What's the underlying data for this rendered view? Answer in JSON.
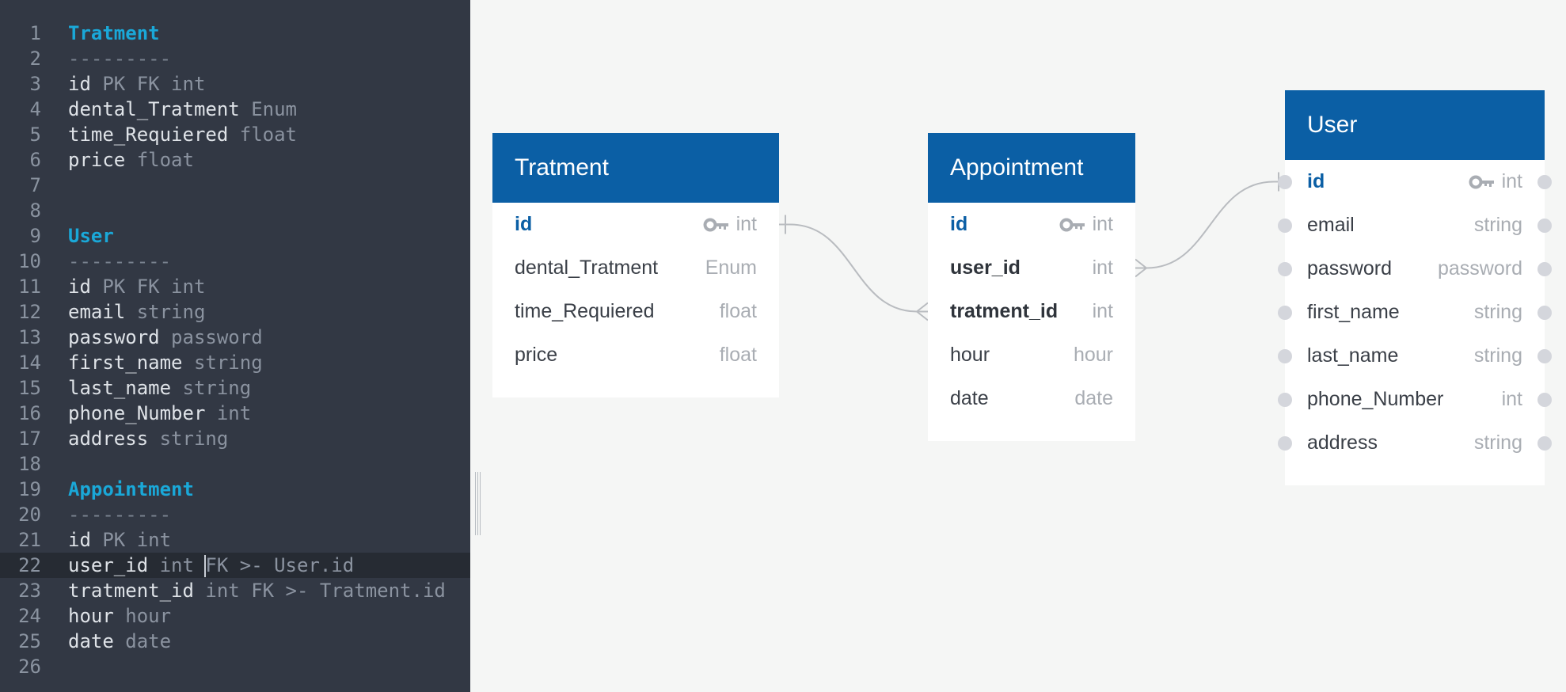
{
  "editor": {
    "lines": [
      {
        "n": "1",
        "segments": [
          {
            "text": "Tratment",
            "cls": "heading"
          }
        ]
      },
      {
        "n": "2",
        "segments": [
          {
            "text": "---------",
            "cls": "dash"
          }
        ]
      },
      {
        "n": "3",
        "segments": [
          {
            "text": "id",
            "cls": "name"
          },
          {
            "text": " PK FK int",
            "cls": "type"
          }
        ]
      },
      {
        "n": "4",
        "segments": [
          {
            "text": "dental_Tratment",
            "cls": "name"
          },
          {
            "text": " Enum",
            "cls": "type"
          }
        ]
      },
      {
        "n": "5",
        "segments": [
          {
            "text": "time_Requiered",
            "cls": "name"
          },
          {
            "text": " float",
            "cls": "type"
          }
        ]
      },
      {
        "n": "6",
        "segments": [
          {
            "text": "price",
            "cls": "name"
          },
          {
            "text": " float",
            "cls": "type"
          }
        ]
      },
      {
        "n": "7",
        "segments": []
      },
      {
        "n": "8",
        "segments": []
      },
      {
        "n": "9",
        "segments": [
          {
            "text": "User",
            "cls": "heading"
          }
        ]
      },
      {
        "n": "10",
        "segments": [
          {
            "text": "---------",
            "cls": "dash"
          }
        ]
      },
      {
        "n": "11",
        "segments": [
          {
            "text": "id",
            "cls": "name"
          },
          {
            "text": " PK FK int",
            "cls": "type"
          }
        ]
      },
      {
        "n": "12",
        "segments": [
          {
            "text": "email",
            "cls": "name"
          },
          {
            "text": " string",
            "cls": "type"
          }
        ]
      },
      {
        "n": "13",
        "segments": [
          {
            "text": "password",
            "cls": "name"
          },
          {
            "text": " password",
            "cls": "type"
          }
        ]
      },
      {
        "n": "14",
        "segments": [
          {
            "text": "first_name",
            "cls": "name"
          },
          {
            "text": " string",
            "cls": "type"
          }
        ]
      },
      {
        "n": "15",
        "segments": [
          {
            "text": "last_name",
            "cls": "name"
          },
          {
            "text": " string",
            "cls": "type"
          }
        ]
      },
      {
        "n": "16",
        "segments": [
          {
            "text": "phone_Number",
            "cls": "name"
          },
          {
            "text": " int",
            "cls": "type"
          }
        ]
      },
      {
        "n": "17",
        "segments": [
          {
            "text": "address",
            "cls": "name"
          },
          {
            "text": " string",
            "cls": "type"
          }
        ]
      },
      {
        "n": "18",
        "segments": []
      },
      {
        "n": "19",
        "segments": [
          {
            "text": "Appointment",
            "cls": "heading"
          }
        ]
      },
      {
        "n": "20",
        "segments": [
          {
            "text": "---------",
            "cls": "dash"
          }
        ]
      },
      {
        "n": "21",
        "segments": [
          {
            "text": "id",
            "cls": "name"
          },
          {
            "text": " PK int",
            "cls": "type"
          }
        ]
      },
      {
        "n": "22",
        "active": true,
        "segments": [
          {
            "text": "user_id",
            "cls": "name"
          },
          {
            "text": " int ",
            "cls": "type"
          },
          {
            "caret": true
          },
          {
            "text": "FK >- User.id",
            "cls": "type"
          }
        ]
      },
      {
        "n": "23",
        "segments": [
          {
            "text": "tratment_id",
            "cls": "name"
          },
          {
            "text": " int FK >- Tratment.id",
            "cls": "type"
          }
        ]
      },
      {
        "n": "24",
        "segments": [
          {
            "text": "hour",
            "cls": "name"
          },
          {
            "text": " hour",
            "cls": "type"
          }
        ]
      },
      {
        "n": "25",
        "segments": [
          {
            "text": "date",
            "cls": "name"
          },
          {
            "text": " date",
            "cls": "type"
          }
        ]
      },
      {
        "n": "26",
        "segments": []
      }
    ]
  },
  "diagram": {
    "colors": {
      "header": "#0b5fa5",
      "connector": "#b9bcc0",
      "dot": "#d4d6dc"
    },
    "tables": [
      {
        "key": "tratment",
        "title": "Tratment",
        "fields": [
          {
            "name": "id",
            "type": "int",
            "pk": true
          },
          {
            "name": "dental_Tratment",
            "type": "Enum"
          },
          {
            "name": "time_Requiered",
            "type": "float"
          },
          {
            "name": "price",
            "type": "float"
          }
        ]
      },
      {
        "key": "appointment",
        "title": "Appointment",
        "fields": [
          {
            "name": "id",
            "type": "int",
            "pk": true
          },
          {
            "name": "user_id",
            "type": "int",
            "bold": true
          },
          {
            "name": "tratment_id",
            "type": "int",
            "bold": true
          },
          {
            "name": "hour",
            "type": "hour"
          },
          {
            "name": "date",
            "type": "date"
          }
        ]
      },
      {
        "key": "user",
        "title": "User",
        "dots": true,
        "fields": [
          {
            "name": "id",
            "type": "int",
            "pk": true
          },
          {
            "name": "email",
            "type": "string"
          },
          {
            "name": "password",
            "type": "password"
          },
          {
            "name": "first_name",
            "type": "string"
          },
          {
            "name": "last_name",
            "type": "string"
          },
          {
            "name": "phone_Number",
            "type": "int"
          },
          {
            "name": "address",
            "type": "string"
          }
        ]
      }
    ],
    "relations": [
      {
        "from": "appointment.tratment_id",
        "to": "tratment.id",
        "from_end": "many",
        "to_end": "one"
      },
      {
        "from": "appointment.user_id",
        "to": "user.id",
        "from_end": "many",
        "to_end": "one"
      }
    ]
  }
}
